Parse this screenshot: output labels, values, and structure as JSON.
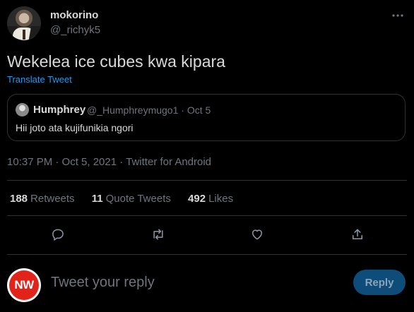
{
  "author": {
    "display_name": "mokorino",
    "handle": "@_richyk5"
  },
  "tweet": {
    "text": "Wekelea ice cubes kwa kipara",
    "translate_label": "Translate Tweet"
  },
  "quoted": {
    "display_name": "Humphrey",
    "meta": "@_Humphreymugo1 · Oct 5",
    "text": "Hii joto ata kujifunikia ngori"
  },
  "timestamp": "10:37 PM · Oct 5, 2021 · Twitter for Android",
  "stats": {
    "retweets_count": "188",
    "retweets_label": "Retweets",
    "quotes_count": "11",
    "quotes_label": "Quote Tweets",
    "likes_count": "492",
    "likes_label": "Likes"
  },
  "icons": [
    "more-icon",
    "reply-icon",
    "retweet-icon",
    "like-icon",
    "share-icon"
  ],
  "reply": {
    "avatar_initials": "NW",
    "placeholder": "Tweet your reply",
    "button_label": "Reply"
  },
  "colors": {
    "accent": "#1d9bf0",
    "background": "#000000",
    "muted": "#6e767d",
    "divider": "#2f3336",
    "avatar_red": "#e2231a"
  }
}
